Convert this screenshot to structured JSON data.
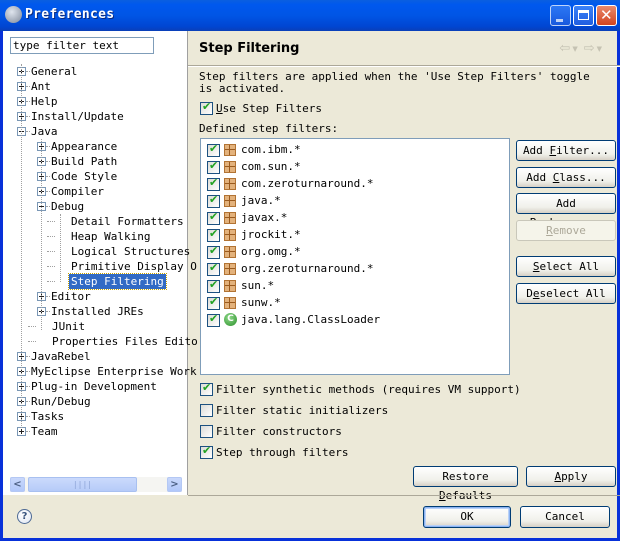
{
  "window": {
    "title": "Preferences"
  },
  "sidebar": {
    "filter_placeholder": "type filter text",
    "filter_value": "type filter text",
    "tree": [
      {
        "label": "General",
        "expander": "plus",
        "level": 0
      },
      {
        "label": "Ant",
        "expander": "plus",
        "level": 0
      },
      {
        "label": "Help",
        "expander": "plus",
        "level": 0
      },
      {
        "label": "Install/Update",
        "expander": "plus",
        "level": 0
      },
      {
        "label": "Java",
        "expander": "minus",
        "level": 0
      },
      {
        "label": "Appearance",
        "expander": "plus",
        "level": 1
      },
      {
        "label": "Build Path",
        "expander": "plus",
        "level": 1
      },
      {
        "label": "Code Style",
        "expander": "plus",
        "level": 1
      },
      {
        "label": "Compiler",
        "expander": "plus",
        "level": 1
      },
      {
        "label": "Debug",
        "expander": "minus",
        "level": 1
      },
      {
        "label": "Detail Formatters",
        "expander": "none",
        "level": 2
      },
      {
        "label": "Heap Walking",
        "expander": "none",
        "level": 2
      },
      {
        "label": "Logical Structures",
        "expander": "none",
        "level": 2
      },
      {
        "label": "Primitive Display O",
        "expander": "none",
        "level": 2
      },
      {
        "label": "Step Filtering",
        "expander": "none",
        "level": 2,
        "selected": true
      },
      {
        "label": "Editor",
        "expander": "plus",
        "level": 1
      },
      {
        "label": "Installed JREs",
        "expander": "plus",
        "level": 1
      },
      {
        "label": "JUnit",
        "expander": "none",
        "level": 1
      },
      {
        "label": "Properties Files Edito",
        "expander": "none",
        "level": 1
      },
      {
        "label": "JavaRebel",
        "expander": "plus",
        "level": 0
      },
      {
        "label": "MyEclipse Enterprise Work",
        "expander": "plus",
        "level": 0
      },
      {
        "label": "Plug-in Development",
        "expander": "plus",
        "level": 0
      },
      {
        "label": "Run/Debug",
        "expander": "plus",
        "level": 0
      },
      {
        "label": "Tasks",
        "expander": "plus",
        "level": 0
      },
      {
        "label": "Team",
        "expander": "plus",
        "level": 0
      }
    ]
  },
  "page": {
    "title": "Step Filtering",
    "nav_back_icon": "back-arrow-icon",
    "nav_forward_icon": "forward-arrow-icon",
    "description": "Step filters are applied when the 'Use Step Filters' toggle is activated.",
    "use_step_filters": {
      "label": "Use Step Filters",
      "mnemonic": "U",
      "checked": true
    },
    "defined_label": "Defined step filters:",
    "filters": [
      {
        "pattern": "com.ibm.*",
        "type": "package",
        "checked": true
      },
      {
        "pattern": "com.sun.*",
        "type": "package",
        "checked": true
      },
      {
        "pattern": "com.zeroturnaround.*",
        "type": "package",
        "checked": true
      },
      {
        "pattern": "java.*",
        "type": "package",
        "checked": true
      },
      {
        "pattern": "javax.*",
        "type": "package",
        "checked": true
      },
      {
        "pattern": "jrockit.*",
        "type": "package",
        "checked": true
      },
      {
        "pattern": "org.omg.*",
        "type": "package",
        "checked": true
      },
      {
        "pattern": "org.zeroturnaround.*",
        "type": "package",
        "checked": true
      },
      {
        "pattern": "sun.*",
        "type": "package",
        "checked": true
      },
      {
        "pattern": "sunw.*",
        "type": "package",
        "checked": true
      },
      {
        "pattern": "java.lang.ClassLoader",
        "type": "class",
        "checked": true
      }
    ],
    "buttons": {
      "add_filter": "Add Filter...",
      "add_class": "Add Class...",
      "add_packages": "Add Packages...",
      "remove": "Remove",
      "select_all": "Select All",
      "deselect_all": "Deselect All"
    },
    "options": [
      {
        "label": "Filter synthetic methods (requires VM support)",
        "checked": true
      },
      {
        "label": "Filter static initializers",
        "checked": false
      },
      {
        "label": "Filter constructors",
        "checked": false
      },
      {
        "label": "Step through filters",
        "checked": true
      }
    ],
    "restore_defaults": "Restore Defaults",
    "apply": "Apply"
  },
  "footer": {
    "help_icon": "help-icon",
    "ok": "OK",
    "cancel": "Cancel"
  }
}
